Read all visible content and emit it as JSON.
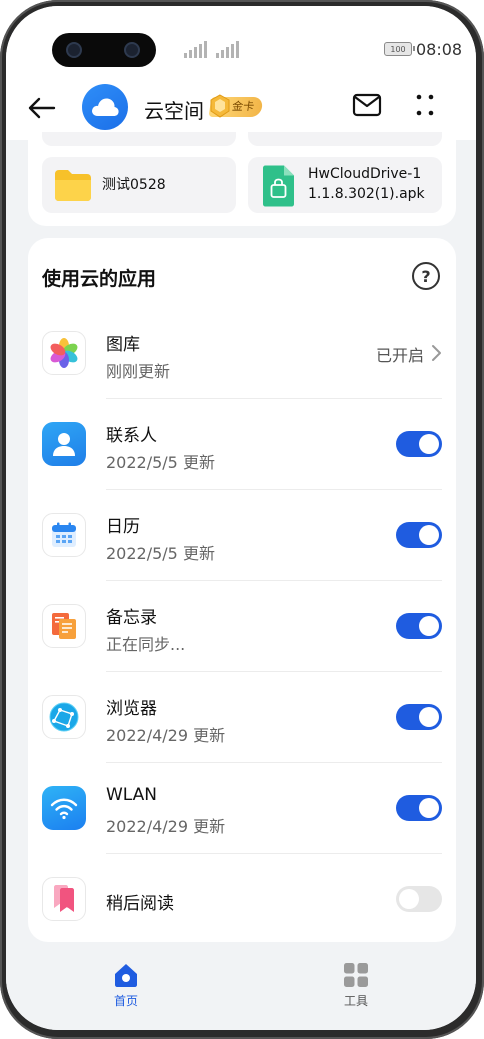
{
  "status_bar": {
    "time": "08:08",
    "battery": "100"
  },
  "header": {
    "title": "云空间",
    "badge": "金卡"
  },
  "files": [
    {
      "name": "测试0528",
      "type": "folder"
    },
    {
      "name_line1": "HwCloudDrive-1",
      "name_line2": "1.1.8.302(1).apk",
      "type": "apk"
    }
  ],
  "apps_section": {
    "title": "使用云的应用",
    "help": "?",
    "apps": [
      {
        "name": "图库",
        "status": "刚刚更新",
        "control": "link",
        "control_text": "已开启",
        "icon": "gallery-icon"
      },
      {
        "name": "联系人",
        "status": "2022/5/5 更新",
        "control": "toggle",
        "enabled": true,
        "icon": "contacts-icon"
      },
      {
        "name": "日历",
        "status": "2022/5/5 更新",
        "control": "toggle",
        "enabled": true,
        "icon": "calendar-icon"
      },
      {
        "name": "备忘录",
        "status": "正在同步...",
        "control": "toggle",
        "enabled": true,
        "icon": "notepad-icon"
      },
      {
        "name": "浏览器",
        "status": "2022/4/29 更新",
        "control": "toggle",
        "enabled": true,
        "icon": "browser-icon"
      },
      {
        "name": "WLAN",
        "status": "2022/4/29 更新",
        "control": "toggle",
        "enabled": true,
        "icon": "wlan-icon"
      },
      {
        "name": "稍后阅读",
        "status": "",
        "control": "toggle",
        "enabled": false,
        "icon": "read-later-icon"
      }
    ]
  },
  "bottom_nav": [
    {
      "label": "首页",
      "active": true,
      "icon": "home-icon"
    },
    {
      "label": "工具",
      "active": false,
      "icon": "tools-icon"
    }
  ],
  "colors": {
    "accent": "#1f5ce0",
    "background": "#f1f3f5",
    "card": "#ffffff"
  }
}
